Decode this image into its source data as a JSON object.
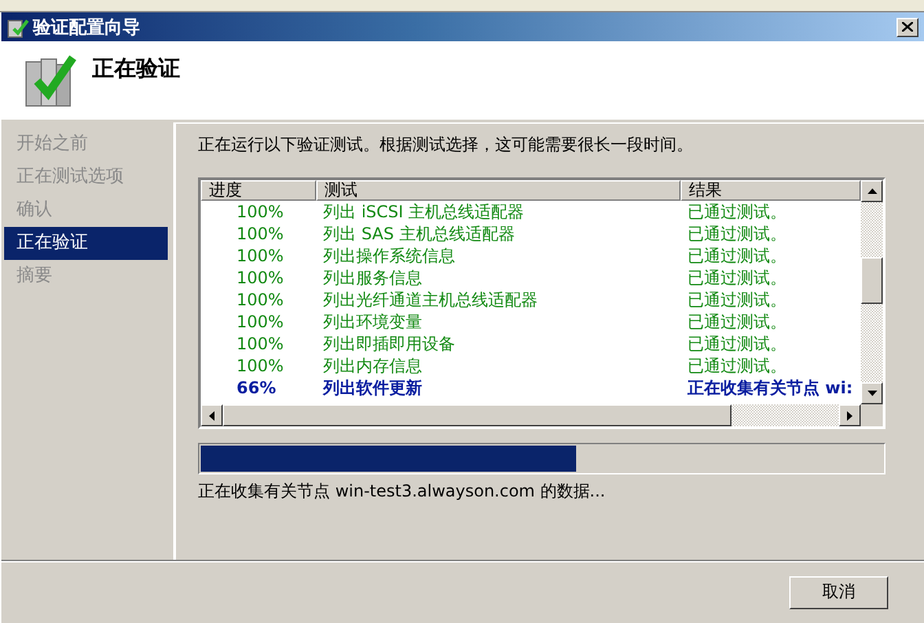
{
  "window": {
    "title": "验证配置向导"
  },
  "header": {
    "title": "正在验证"
  },
  "sidebar": {
    "items": [
      {
        "label": "开始之前",
        "selected": false
      },
      {
        "label": "正在测试选项",
        "selected": false
      },
      {
        "label": "确认",
        "selected": false
      },
      {
        "label": "正在验证",
        "selected": true
      },
      {
        "label": "摘要",
        "selected": false
      }
    ]
  },
  "intro": "正在运行以下验证测试。根据测试选择，这可能需要很长一段时间。",
  "table": {
    "columns": [
      "进度",
      "测试",
      "结果"
    ],
    "rows": [
      {
        "kind": "done",
        "progress": "100%",
        "test": "列出 iSCSI 主机总线适配器",
        "result": "已通过测试。"
      },
      {
        "kind": "done",
        "progress": "100%",
        "test": "列出 SAS 主机总线适配器",
        "result": "已通过测试。"
      },
      {
        "kind": "done",
        "progress": "100%",
        "test": "列出操作系统信息",
        "result": "已通过测试。"
      },
      {
        "kind": "done",
        "progress": "100%",
        "test": "列出服务信息",
        "result": "已通过测试。"
      },
      {
        "kind": "done",
        "progress": "100%",
        "test": "列出光纤通道主机总线适配器",
        "result": "已通过测试。"
      },
      {
        "kind": "done",
        "progress": "100%",
        "test": "列出环境变量",
        "result": "已通过测试。"
      },
      {
        "kind": "done",
        "progress": "100%",
        "test": "列出即插即用设备",
        "result": "已通过测试。"
      },
      {
        "kind": "done",
        "progress": "100%",
        "test": "列出内存信息",
        "result": "已通过测试。"
      },
      {
        "kind": "running",
        "progress": "66%",
        "test": "列出软件更新",
        "result": "正在收集有关节点 wi:"
      }
    ]
  },
  "progress": {
    "level": 0.55,
    "status": "正在收集有关节点 win-test3.alwayson.com 的数据..."
  },
  "buttons": [
    {
      "label": "取消"
    }
  ]
}
